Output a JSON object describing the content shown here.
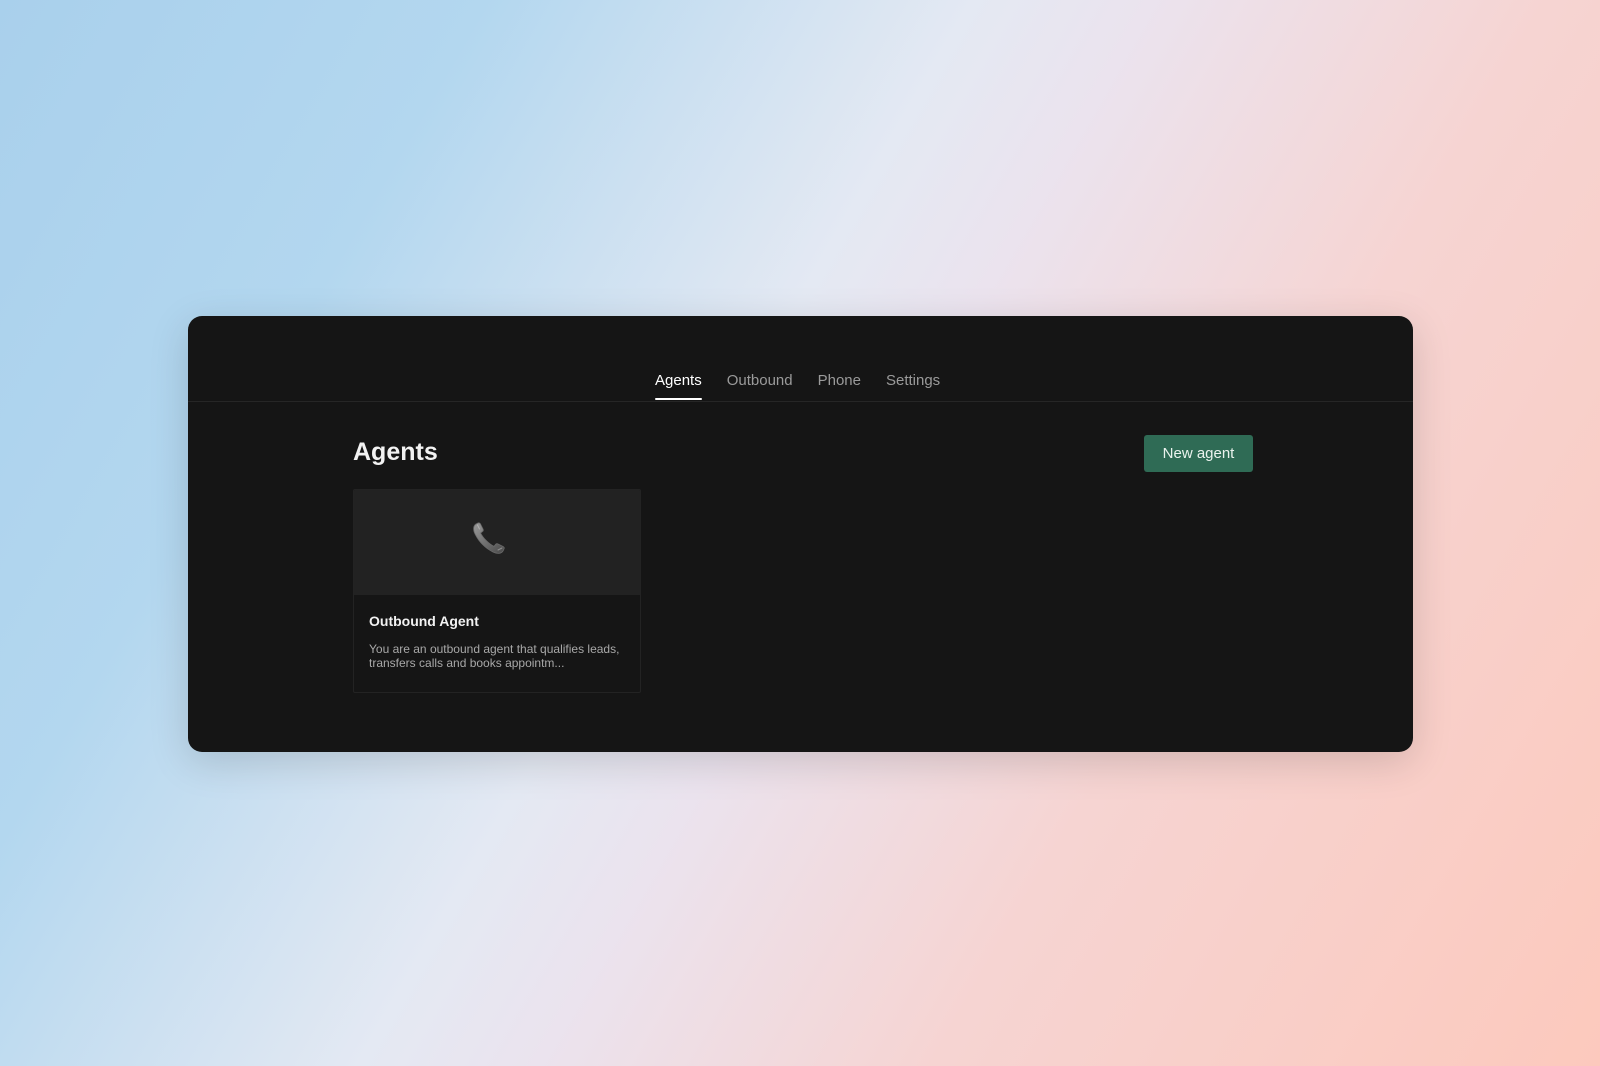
{
  "nav": {
    "tabs": [
      {
        "label": "Agents",
        "active": true
      },
      {
        "label": "Outbound",
        "active": false
      },
      {
        "label": "Phone",
        "active": false
      },
      {
        "label": "Settings",
        "active": false
      }
    ]
  },
  "main": {
    "title": "Agents",
    "new_agent_label": "New agent",
    "cards": [
      {
        "icon": "phone-icon",
        "title": "Outbound Agent",
        "description": "You are an outbound agent that qualifies leads, transfers calls and books appointm..."
      }
    ]
  },
  "colors": {
    "window_bg": "#151515",
    "button_bg": "#2f6b55",
    "card_thumb_bg": "#222222"
  }
}
